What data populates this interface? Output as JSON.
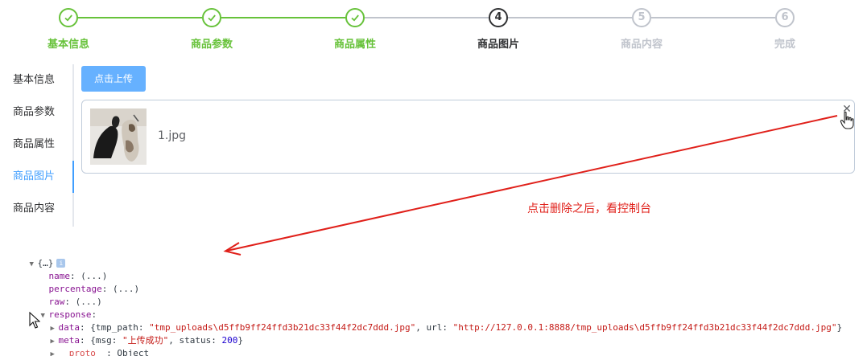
{
  "steps": [
    {
      "num": "1",
      "label": "基本信息",
      "state": "done"
    },
    {
      "num": "2",
      "label": "商品参数",
      "state": "done"
    },
    {
      "num": "3",
      "label": "商品属性",
      "state": "done"
    },
    {
      "num": "4",
      "label": "商品图片",
      "state": "active"
    },
    {
      "num": "5",
      "label": "商品内容",
      "state": "wait"
    },
    {
      "num": "6",
      "label": "完成",
      "state": "wait"
    }
  ],
  "tabs": [
    {
      "label": "基本信息"
    },
    {
      "label": "商品参数"
    },
    {
      "label": "商品属性"
    },
    {
      "label": "商品图片",
      "active": true
    },
    {
      "label": "商品内容"
    }
  ],
  "upload": {
    "button_label": "点击上传",
    "file_name": "1.jpg",
    "close_glyph": "✕"
  },
  "annotation": {
    "text": "点击删除之后，看控制台"
  },
  "console": {
    "root": "{…}",
    "info": "i",
    "name": {
      "key": "name",
      "value": "(...)"
    },
    "percentage": {
      "key": "percentage",
      "value": "(...)"
    },
    "raw": {
      "key": "raw",
      "value": "(...)"
    },
    "response_key": "response",
    "data": {
      "key": "data",
      "tmp_path_key": "tmp_path",
      "tmp_path": "\"tmp_uploads\\d5ffb9ff24ffd3b21dc33f44f2dc7ddd.jpg\"",
      "url_key": "url",
      "url": "\"http://127.0.0.1:8888/tmp_uploads\\d5ffb9ff24ffd3b21dc33f44f2dc7ddd.jpg\""
    },
    "meta": {
      "key": "meta",
      "msg_key": "msg",
      "msg": "\"上传成功\"",
      "status_key": "status",
      "status": "200"
    },
    "proto": {
      "key": "__proto__",
      "value": "Object"
    }
  },
  "colors": {
    "success": "#67c23a",
    "active": "#303133",
    "wait": "#c0c4cc",
    "primary": "#409eff",
    "annotation": "#e0201a"
  }
}
